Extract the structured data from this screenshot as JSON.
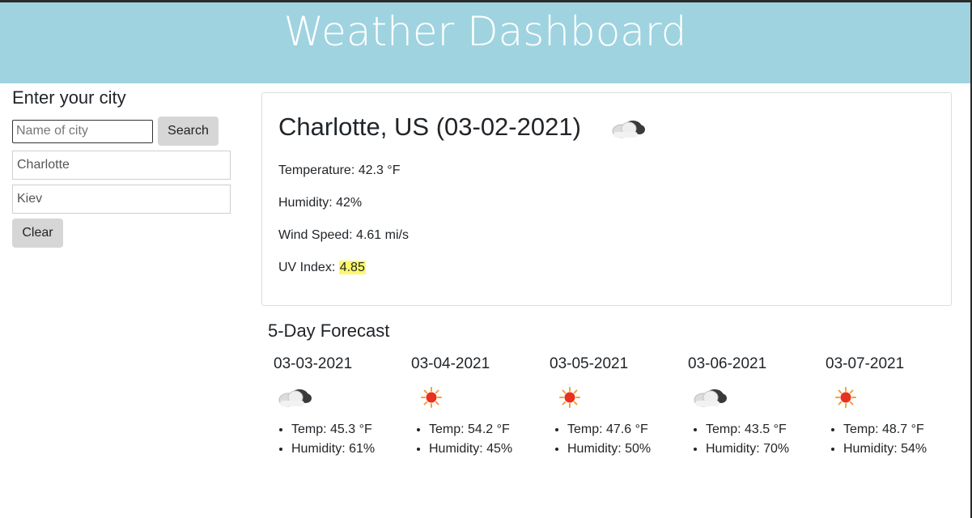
{
  "header": {
    "title": "Weather Dashboard"
  },
  "sidebar": {
    "heading": "Enter your city",
    "search_placeholder": "Name of city",
    "search_label": "Search",
    "history": [
      "Charlotte",
      "Kiev"
    ],
    "clear_label": "Clear"
  },
  "current": {
    "title": "Charlotte, US (03-02-2021)",
    "icon": "cloud-icon",
    "temperature": "Temperature: 42.3 °F",
    "humidity": "Humidity: 42%",
    "wind": "Wind Speed: 4.61 mi/s",
    "uv_label": "UV Index: ",
    "uv_value": "4.85",
    "uv_color": "#fdf86b"
  },
  "forecast": {
    "title": "5-Day Forecast",
    "days": [
      {
        "date": "03-03-2021",
        "icon": "cloud-icon",
        "temp": "Temp: 45.3 °F",
        "humidity": "Humidity: 61%"
      },
      {
        "date": "03-04-2021",
        "icon": "sun-icon",
        "temp": "Temp: 54.2 °F",
        "humidity": "Humidity: 45%"
      },
      {
        "date": "03-05-2021",
        "icon": "sun-icon",
        "temp": "Temp: 47.6 °F",
        "humidity": "Humidity: 50%"
      },
      {
        "date": "03-06-2021",
        "icon": "cloud-icon",
        "temp": "Temp: 43.5 °F",
        "humidity": "Humidity: 70%"
      },
      {
        "date": "03-07-2021",
        "icon": "sun-icon",
        "temp": "Temp: 48.7 °F",
        "humidity": "Humidity: 54%"
      }
    ]
  },
  "colors": {
    "header_bg": "#9fd3e0",
    "header_text": "#ffffff",
    "button_bg": "#d6d6d6"
  }
}
